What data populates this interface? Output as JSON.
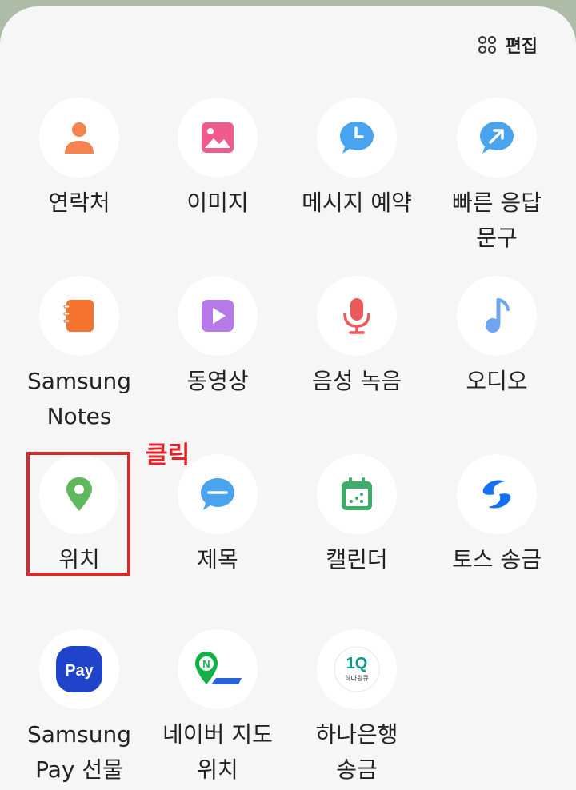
{
  "header": {
    "edit_label": "편집",
    "edit_icon": "grid-four-dots-icon"
  },
  "apps": [
    {
      "id": "contacts",
      "label": "연락처",
      "icon": "person-icon",
      "color": "#f4834f"
    },
    {
      "id": "image",
      "label": "이미지",
      "icon": "image-icon",
      "color": "#ef5b8d"
    },
    {
      "id": "schedule-message",
      "label": "메시지 예약",
      "icon": "clock-bubble-icon",
      "color": "#4aa3ee"
    },
    {
      "id": "quick-reply",
      "label": "빠른 응답\n문구",
      "icon": "arrow-bubble-icon",
      "color": "#4aa3ee"
    },
    {
      "id": "samsung-notes",
      "label": "Samsung\nNotes",
      "icon": "notebook-icon",
      "color": "#f5732f"
    },
    {
      "id": "video",
      "label": "동영상",
      "icon": "play-icon",
      "color": "#b57ae8"
    },
    {
      "id": "voice-record",
      "label": "음성 녹음",
      "icon": "microphone-icon",
      "color": "#ea5a5a"
    },
    {
      "id": "audio",
      "label": "오디오",
      "icon": "music-note-icon",
      "color": "#6ea4f0"
    },
    {
      "id": "location",
      "label": "위치",
      "icon": "location-pin-icon",
      "color": "#5fb85b"
    },
    {
      "id": "subject",
      "label": "제목",
      "icon": "subject-bubble-icon",
      "color": "#4aa3ee"
    },
    {
      "id": "calendar",
      "label": "캘린더",
      "icon": "calendar-icon",
      "color": "#3cae6a"
    },
    {
      "id": "toss",
      "label": "토스 송금",
      "icon": "toss-logo-icon",
      "color": "#1670f5"
    },
    {
      "id": "samsung-pay",
      "label": "Samsung\nPay 선물",
      "icon": "samsung-pay-icon",
      "color": "#1f43c9"
    },
    {
      "id": "naver-map",
      "label": "네이버 지도\n위치",
      "icon": "naver-map-icon",
      "color": "#11b148"
    },
    {
      "id": "hana-bank",
      "label": "하나은행\n송금",
      "icon": "hana-1q-icon",
      "color": "#0c9a89"
    }
  ],
  "overlay": {
    "annotation_text": "클릭",
    "highlight_color": "#d42a2a"
  },
  "icon_text": {
    "pay": "Pay",
    "n": "N",
    "q1": "1Q",
    "hana": "하나원큐"
  }
}
